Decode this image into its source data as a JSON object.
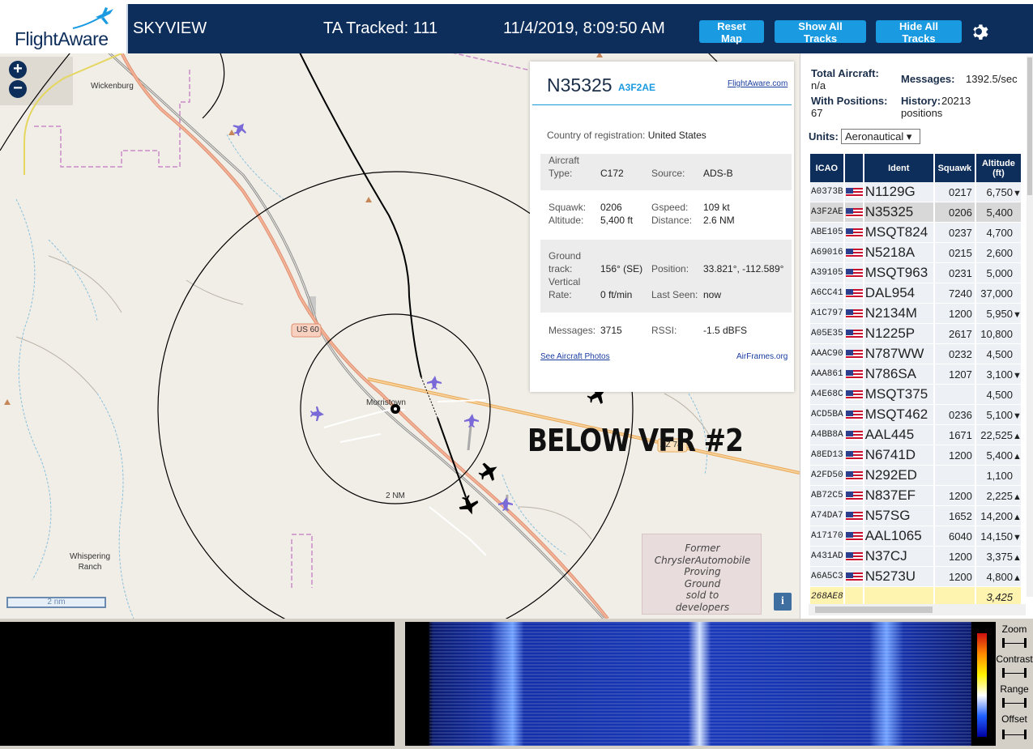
{
  "header": {
    "logo_text": "FlightAware",
    "app_title": "SKYVIEW",
    "ta_tracked": "TA Tracked: 111",
    "datetime": "11/4/2019, 8:09:50 AM",
    "buttons": {
      "reset_map": "Reset Map",
      "show_all_tracks": "Show All Tracks",
      "hide_all_tracks": "Hide All Tracks"
    },
    "accent_color": "#1a9ae0",
    "bar_color": "#0d2d5a"
  },
  "map": {
    "zoom_in": "+",
    "zoom_out": "−",
    "labels": {
      "wickenburg": "Wickenburg",
      "us60": "US 60",
      "morristown": "Morristown",
      "ring_label": "2 NM",
      "whispering_ranch": "Whispering\nRanch",
      "az74": "AZ 74"
    },
    "scale_bar": "2 nm",
    "proving_ground": "Former\nChryslerAutomobile\nProving\nGround\nsold to\ndevelopers",
    "overlay_text": "BELOW VFR #2",
    "info_button": "i"
  },
  "popup": {
    "ident": "N35325",
    "hex": "A3F2AE",
    "flightaware_link": "FlightAware.com",
    "country_label": "Country of registration:",
    "country_value": "United States",
    "aircraft_type_label": "Aircraft\nType:",
    "aircraft_type_value": "C172",
    "source_label": "Source:",
    "source_value": "ADS-B",
    "squawk_label": "Squawk:",
    "squawk_value": "0206",
    "altitude_label": "Altitude:",
    "altitude_value": "5,400 ft",
    "gspeed_label": "Gspeed:",
    "gspeed_value": "109 kt",
    "distance_label": "Distance:",
    "distance_value": "2.6 NM",
    "ground_track_label": "Ground\ntrack:",
    "ground_track_value": "156° (SE)",
    "position_label": "Position:",
    "position_value": "33.821°, -112.589°",
    "vertical_rate_label": "Vertical\nRate:",
    "vertical_rate_value": "0 ft/min",
    "last_seen_label": "Last Seen:",
    "last_seen_value": "now",
    "messages_label": "Messages:",
    "messages_value": "3715",
    "rssi_label": "RSSI:",
    "rssi_value": "-1.5 dBFS",
    "photos_link": "See Aircraft Photos",
    "airframes_link": "AirFrames.org"
  },
  "side": {
    "total_aircraft_label": "Total Aircraft:",
    "total_aircraft_value": "n/a",
    "messages_label": "Messages:",
    "messages_value": "1392.5/sec",
    "with_positions_label": "With Positions:",
    "with_positions_value": "67",
    "history_label": "History:",
    "history_value": "20213",
    "history_unit": "positions",
    "units_label": "Units:",
    "units_value": "Aeronautical ▾",
    "columns": [
      "ICAO",
      "",
      "Ident",
      "Squawk",
      "Altitude\n(ft)"
    ],
    "rows": [
      {
        "icao": "A0373B",
        "ident": "N1129G",
        "squawk": "0217",
        "alt": "6,750",
        "trend": "▼"
      },
      {
        "icao": "A3F2AE",
        "ident": "N35325",
        "squawk": "0206",
        "alt": "5,400",
        "trend": ""
      },
      {
        "icao": "ABE105",
        "ident": "MSQT824",
        "squawk": "0237",
        "alt": "4,700",
        "trend": ""
      },
      {
        "icao": "A69016",
        "ident": "N5218A",
        "squawk": "0215",
        "alt": "2,600",
        "trend": ""
      },
      {
        "icao": "A39105",
        "ident": "MSQT963",
        "squawk": "0231",
        "alt": "5,000",
        "trend": ""
      },
      {
        "icao": "A6CC41",
        "ident": "DAL954",
        "squawk": "7240",
        "alt": "37,000",
        "trend": ""
      },
      {
        "icao": "A1C797",
        "ident": "N2134M",
        "squawk": "1200",
        "alt": "5,950",
        "trend": "▼"
      },
      {
        "icao": "A05E35",
        "ident": "N1225P",
        "squawk": "2617",
        "alt": "10,800",
        "trend": ""
      },
      {
        "icao": "AAAC90",
        "ident": "N787WW",
        "squawk": "0232",
        "alt": "4,500",
        "trend": ""
      },
      {
        "icao": "AAA861",
        "ident": "N786SA",
        "squawk": "1207",
        "alt": "3,100",
        "trend": "▼"
      },
      {
        "icao": "A4E68C",
        "ident": "MSQT375",
        "squawk": "",
        "alt": "4,500",
        "trend": ""
      },
      {
        "icao": "ACD5BA",
        "ident": "MSQT462",
        "squawk": "0236",
        "alt": "5,100",
        "trend": "▼"
      },
      {
        "icao": "A4BB8A",
        "ident": "AAL445",
        "squawk": "1671",
        "alt": "22,525",
        "trend": "▲"
      },
      {
        "icao": "A8ED13",
        "ident": "N6741D",
        "squawk": "1200",
        "alt": "5,400",
        "trend": "▲"
      },
      {
        "icao": "A2FD50",
        "ident": "N292ED",
        "squawk": "",
        "alt": "1,100",
        "trend": ""
      },
      {
        "icao": "AB72C5",
        "ident": "N837EF",
        "squawk": "1200",
        "alt": "2,225",
        "trend": "▲"
      },
      {
        "icao": "A74DA7",
        "ident": "N57SG",
        "squawk": "1652",
        "alt": "14,200",
        "trend": "▲"
      },
      {
        "icao": "A17170",
        "ident": "AAL1065",
        "squawk": "6040",
        "alt": "14,150",
        "trend": "▼"
      },
      {
        "icao": "A431AD",
        "ident": "N37CJ",
        "squawk": "1200",
        "alt": "3,375",
        "trend": "▲"
      },
      {
        "icao": "A6A5C3",
        "ident": "N5273U",
        "squawk": "1200",
        "alt": "4,800",
        "trend": "▲"
      },
      {
        "icao": "268AE8",
        "ident": "",
        "squawk": "",
        "alt": "3,425",
        "trend": ""
      }
    ]
  },
  "spectrum": {
    "controls": [
      "Zoom",
      "Contrast",
      "Range",
      "Offset"
    ]
  }
}
